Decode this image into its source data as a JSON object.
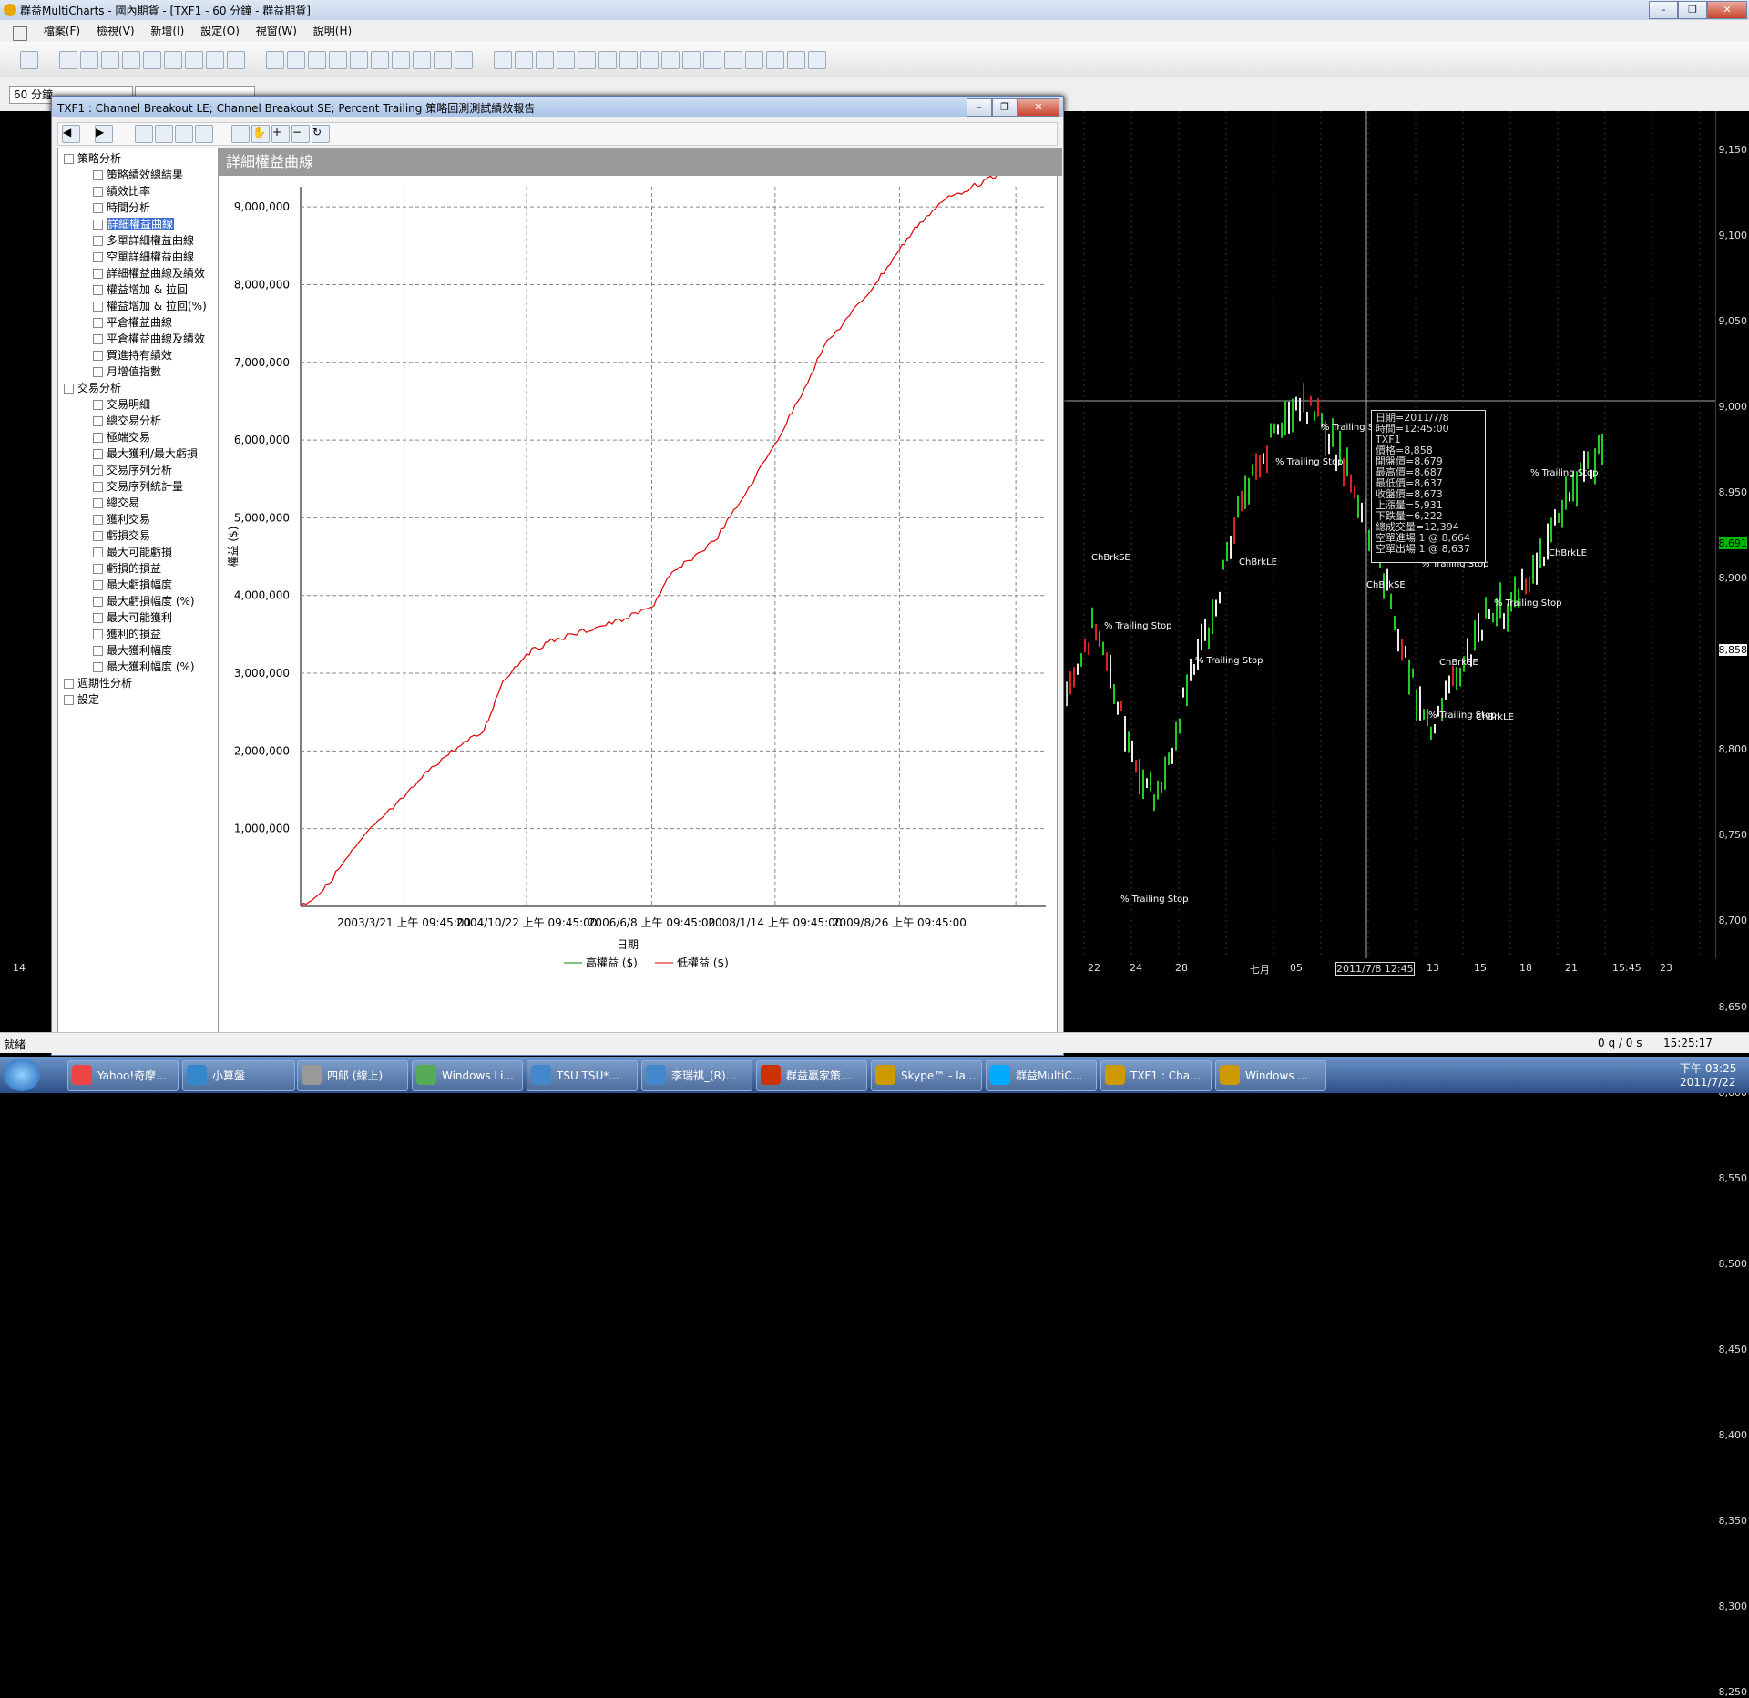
{
  "app": {
    "title": "群益MultiCharts - 國內期貨 - [TXF1 - 60 分鐘 - 群益期貨]",
    "menu": [
      "檔案(F)",
      "檢視(V)",
      "新增(I)",
      "設定(O)",
      "視窗(W)",
      "說明(H)"
    ],
    "interval": "60 分鐘"
  },
  "chart": {
    "price_labels": [
      "9,150",
      "9,100",
      "9,050",
      "9,000",
      "8,950",
      "8,900",
      "8,858",
      "8,800",
      "8,750",
      "8,700",
      "8,650",
      "8,600",
      "8,550",
      "8,500",
      "8,450",
      "8,400",
      "8,350",
      "8,300",
      "8,250"
    ],
    "date_labels": [
      "14",
      "22",
      "24",
      "28",
      "七月",
      "05",
      "2011/7/8 12:45",
      "13",
      "15",
      "18",
      "21",
      "15:45",
      "23"
    ],
    "current_price": "8,858",
    "last_price": "8,691",
    "tooltip": [
      "日期=2011/7/8",
      "時間=12:45:00",
      "TXF1",
      "價格=8,858",
      "開盤價=8,679",
      "最高價=8,687",
      "最低價=8,637",
      "收盤價=8,673",
      "上漲量=5,931",
      "下跌量=6,222",
      "總成交量=12,394",
      "空單進場 1 @ 8,664",
      "空單出場 1 @ 8,637"
    ],
    "labels": {
      "trailing": "% Trailing Stop",
      "chbrkle": "ChBrkLE",
      "chbrkse": "ChBrkSE",
      "one": "1"
    }
  },
  "report": {
    "title": "TXF1 : Channel Breakout LE; Channel Breakout SE; Percent Trailing 策略回測測試績效報告",
    "panel_title": "詳細權益曲線",
    "tree": [
      {
        "label": "策略分析",
        "level": 0,
        "group": true
      },
      {
        "label": "策略績效總結果",
        "level": 1
      },
      {
        "label": "績效比率",
        "level": 1
      },
      {
        "label": "時間分析",
        "level": 1
      },
      {
        "label": "詳細權益曲線",
        "level": 1,
        "selected": true
      },
      {
        "label": "多單詳細權益曲線",
        "level": 1
      },
      {
        "label": "空單詳細權益曲線",
        "level": 1
      },
      {
        "label": "詳細權益曲線及績效",
        "level": 1
      },
      {
        "label": "權益增加 & 拉回",
        "level": 1
      },
      {
        "label": "權益增加 & 拉回(%)",
        "level": 1
      },
      {
        "label": "平倉權益曲線",
        "level": 1
      },
      {
        "label": "平倉權益曲線及績效",
        "level": 1
      },
      {
        "label": "買進持有績效",
        "level": 1
      },
      {
        "label": "月增值指數",
        "level": 1
      },
      {
        "label": "交易分析",
        "level": 0,
        "group": true
      },
      {
        "label": "交易明細",
        "level": 1
      },
      {
        "label": "總交易分析",
        "level": 1
      },
      {
        "label": "極端交易",
        "level": 1
      },
      {
        "label": "最大獲利/最大虧損",
        "level": 1
      },
      {
        "label": "交易序列分析",
        "level": 1
      },
      {
        "label": "交易序列統計量",
        "level": 1
      },
      {
        "label": "總交易",
        "level": 1
      },
      {
        "label": "獲利交易",
        "level": 1
      },
      {
        "label": "虧損交易",
        "level": 1
      },
      {
        "label": "最大可能虧損",
        "level": 1
      },
      {
        "label": "虧損的損益",
        "level": 1
      },
      {
        "label": "最大虧損幅度",
        "level": 1
      },
      {
        "label": "最大虧損幅度 (%)",
        "level": 1
      },
      {
        "label": "最大可能獲利",
        "level": 1
      },
      {
        "label": "獲利的損益",
        "level": 1
      },
      {
        "label": "最大獲利幅度",
        "level": 1
      },
      {
        "label": "最大獲利幅度 (%)",
        "level": 1
      },
      {
        "label": "週期性分析",
        "level": 0,
        "group": true
      },
      {
        "label": "設定",
        "level": 0
      }
    ],
    "legend": {
      "high": "高權益 ($)",
      "low": "低權益 ($)"
    }
  },
  "chart_data": {
    "type": "line",
    "title": "詳細權益曲線",
    "xlabel": "日期",
    "ylabel": "權益 ($)",
    "y_ticks": [
      "1,000,000",
      "2,000,000",
      "3,000,000",
      "4,000,000",
      "5,000,000",
      "6,000,000",
      "7,000,000",
      "8,000,000",
      "9,000,000"
    ],
    "x_ticks": [
      "2003/3/21 上午 09:45:00",
      "2004/10/22 上午 09:45:00",
      "2006/6/8 上午 09:45:00",
      "2008/1/14 上午 09:45:00",
      "2009/8/26 上午 09:45:00"
    ],
    "ylim": [
      0,
      10000000
    ],
    "series": [
      {
        "name": "低權益 ($)",
        "color": "#e00000",
        "x": [
          "2001/11/15",
          "2002/03/01",
          "2002/07/01",
          "2002/11/01",
          "2003/03/21",
          "2003/08/01",
          "2003/12/01",
          "2004/04/01",
          "2004/07/01",
          "2004/10/22",
          "2005/02/01",
          "2005/06/01",
          "2005/10/01",
          "2006/02/01",
          "2006/06/08",
          "2006/09/01",
          "2006/12/01",
          "2007/04/01",
          "2007/08/01",
          "2008/01/14",
          "2008/05/01",
          "2008/09/01",
          "2009/01/01",
          "2009/05/01",
          "2009/08/26",
          "2009/12/01",
          "2010/04/01",
          "2010/08/01",
          "2010/12/01",
          "2011/03/01",
          "2011/07/21"
        ],
        "values": [
          0,
          200000,
          650000,
          1050000,
          1400000,
          1800000,
          2050000,
          2250000,
          2900000,
          3250000,
          3400000,
          3500000,
          3600000,
          3700000,
          3850000,
          4250000,
          4450000,
          4700000,
          5200000,
          5950000,
          6500000,
          7200000,
          7600000,
          8000000,
          8450000,
          8800000,
          9100000,
          9250000,
          9400000,
          9550000,
          9900000
        ]
      },
      {
        "name": "高權益 ($)",
        "color": "#008000",
        "x": [],
        "values": []
      }
    ]
  },
  "status": {
    "left": "就緒",
    "mid": "0 q / 0 s",
    "time": "15:25:17"
  },
  "taskbar": {
    "items": [
      "Yahoo!奇摩...",
      "小算盤",
      "四郎 (線上)",
      "Windows Li...",
      "TSU TSU*...",
      "李瑞祺_(R)...",
      "群益贏家策...",
      "Skype™ - la...",
      "群益MultiC...",
      "TXF1 : Cha...",
      "Windows ..."
    ],
    "clock_time": "下午 03:25",
    "clock_date": "2011/7/22"
  }
}
